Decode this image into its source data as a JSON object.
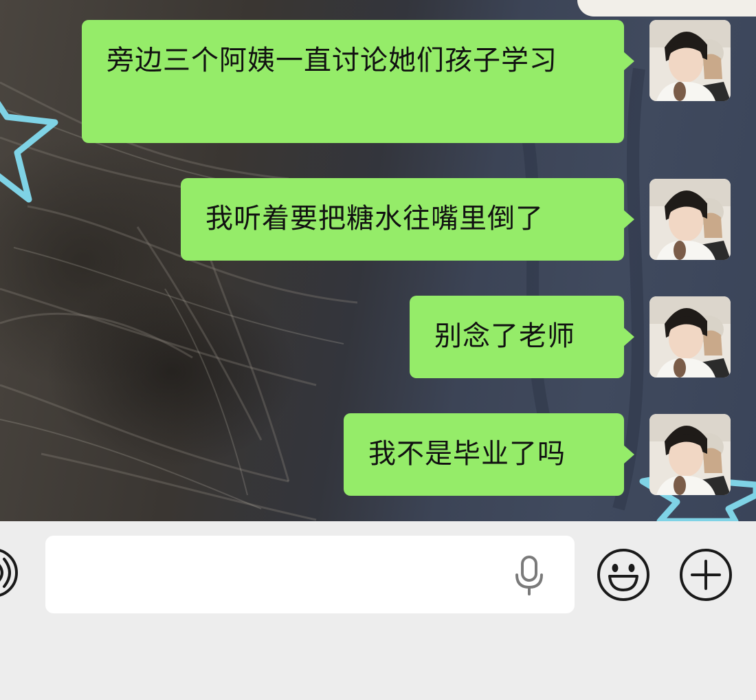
{
  "chat": {
    "messages": [
      {
        "sender": "self",
        "text": "旁边三个阿姨一直讨论她们孩子学习"
      },
      {
        "sender": "self",
        "text": "我听着要把糖水往嘴里倒了"
      },
      {
        "sender": "self",
        "text": "别念了老师"
      },
      {
        "sender": "self",
        "text": "我不是毕业了吗"
      }
    ],
    "bubble_color": "#95ec69"
  },
  "input_bar": {
    "value": "",
    "placeholder": "",
    "icons": {
      "voice": "voice-toggle-icon",
      "mic": "microphone-icon",
      "emoji": "emoji-icon",
      "more": "plus-icon"
    }
  }
}
